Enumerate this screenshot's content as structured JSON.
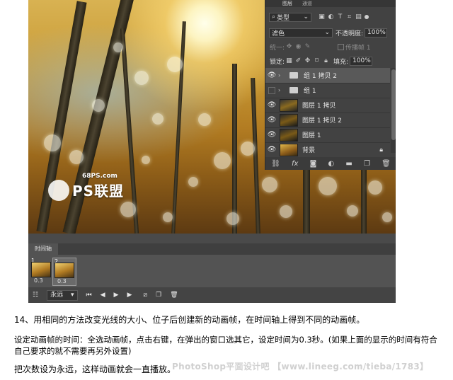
{
  "layers_panel": {
    "tabs": [
      "图层",
      "通道"
    ],
    "filter_label": "类型",
    "blend_mode": "滤色",
    "opacity_label": "不透明度:",
    "opacity_value": "100%",
    "unify_label": "统一:",
    "propagate_label": "传播帧 1",
    "lock_label": "锁定:",
    "fill_label": "填充:",
    "fill_value": "100%",
    "layers": [
      {
        "name": "组 1 拷贝 2",
        "kind": "group",
        "visible": true,
        "selected": true
      },
      {
        "name": "组 1",
        "kind": "group",
        "visible": false,
        "selected": false
      },
      {
        "name": "图层 1 拷贝",
        "kind": "layer",
        "visible": true,
        "selected": false
      },
      {
        "name": "图层 1 拷贝 2",
        "kind": "layer",
        "visible": true,
        "selected": false
      },
      {
        "name": "图层 1",
        "kind": "layer",
        "visible": true,
        "selected": false
      },
      {
        "name": "背景",
        "kind": "background",
        "visible": true,
        "selected": false
      }
    ]
  },
  "timeline": {
    "tab_label": "时间轴",
    "frames": [
      {
        "number": "1",
        "delay": "0.3"
      },
      {
        "number": "2",
        "delay": "0.3"
      }
    ],
    "loop_option": "永远"
  },
  "logo": {
    "url": "68PS.com",
    "text": "PS联盟"
  },
  "article": {
    "step_14": "14、用相同的方法改变光线的大小、位子后创建新的动画帧，在时间轴上得到不同的动画帧。",
    "timing_note": "设定动画帧的时间：全选动画帧，点击右键，在弹出的窗口选其它，设定时间为0.3秒。(如果上面的显示的时间有符合自己要求的就不需要再另外设置)",
    "loop_note": "把次数设为永远，这样动画就会一直播放。"
  },
  "watermark": "PhotoShop平面设计吧 【www.lineeg.com/tieba/1783】"
}
